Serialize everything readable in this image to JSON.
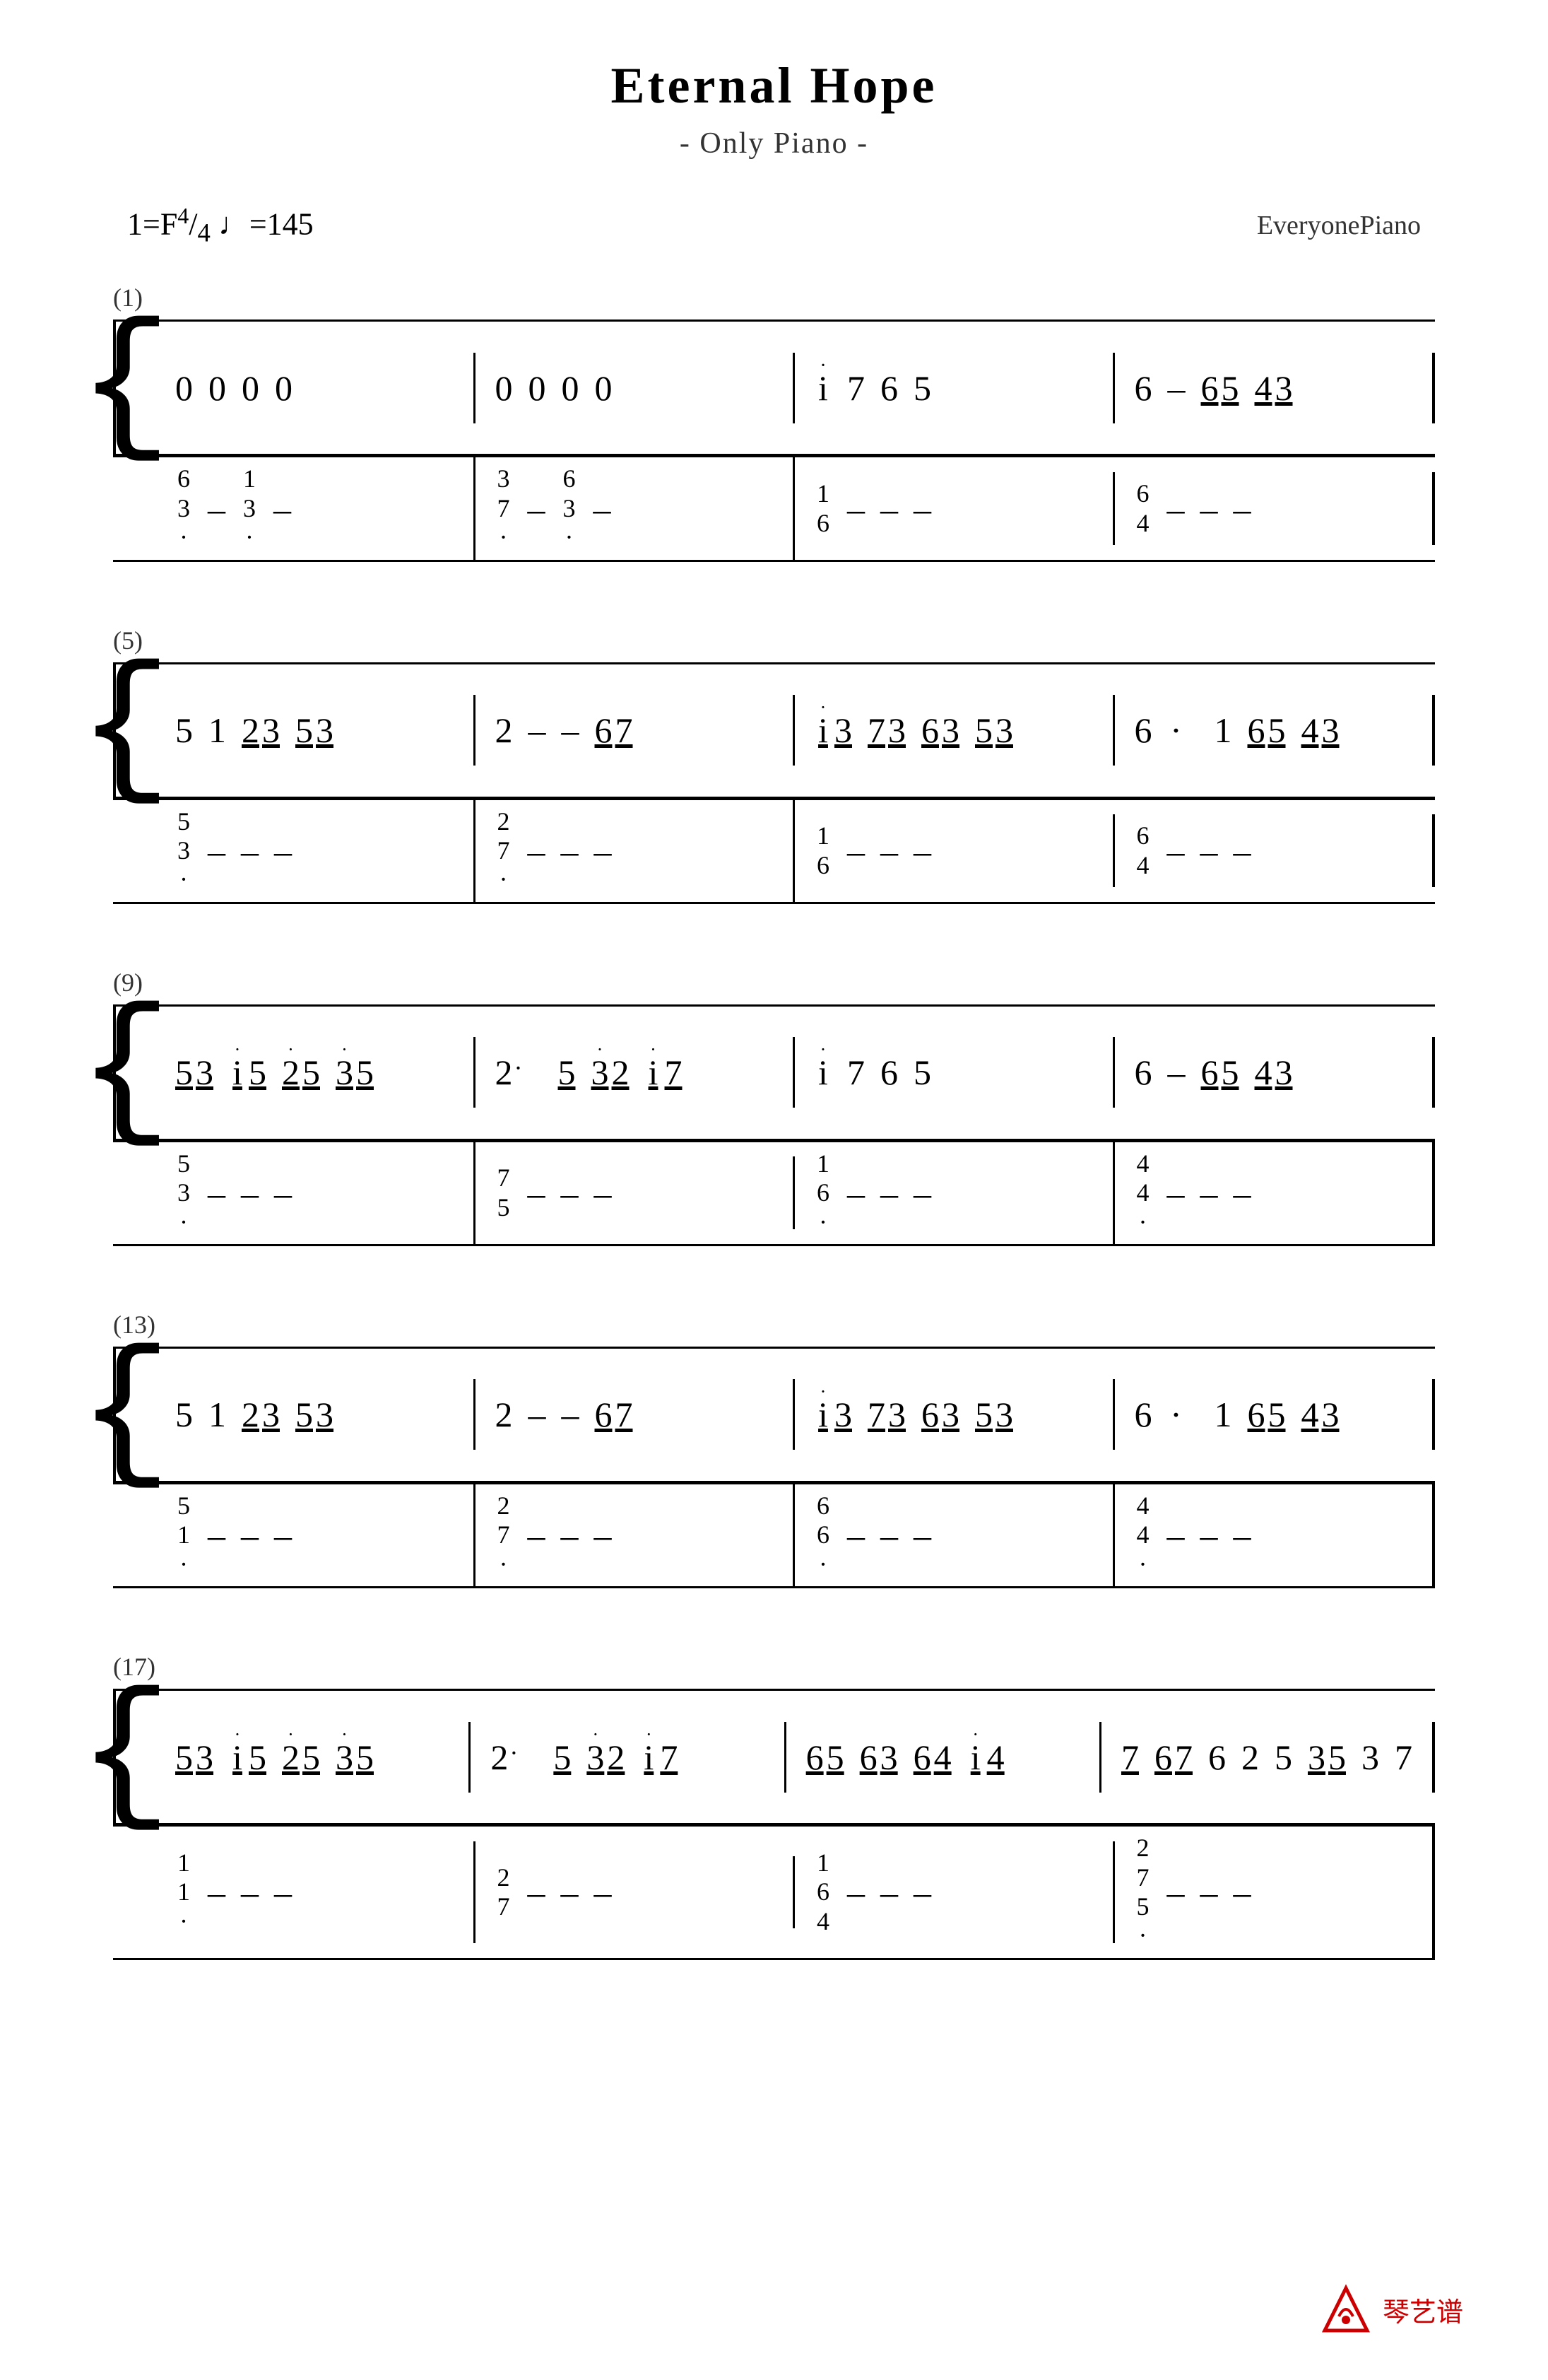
{
  "title": "Eternal Hope",
  "subtitle": "- Only Piano -",
  "key": "1=F",
  "time_sig": "4/4",
  "tempo": "♩=145",
  "publisher": "EveryonePiano",
  "measures": {
    "system1": {
      "number": "(1)",
      "treble": [
        [
          "0",
          "0",
          "0",
          "0"
        ],
        [
          "0",
          "0",
          "0",
          "0"
        ],
        [
          "i̇",
          "7",
          "6",
          "5"
        ],
        [
          "6",
          "–",
          "6̲5̲",
          "4̲3̲"
        ]
      ],
      "bass": [
        [
          "6̣3̣",
          "–",
          "1̣3̣",
          "–"
        ],
        [
          "3̣7̣",
          "–",
          "6̣3̣",
          "–"
        ],
        [
          "1̣6",
          "–",
          "–",
          "–"
        ],
        [
          "6̣4",
          "–",
          "–",
          "–"
        ]
      ]
    }
  },
  "logo_text": "琴艺谱"
}
